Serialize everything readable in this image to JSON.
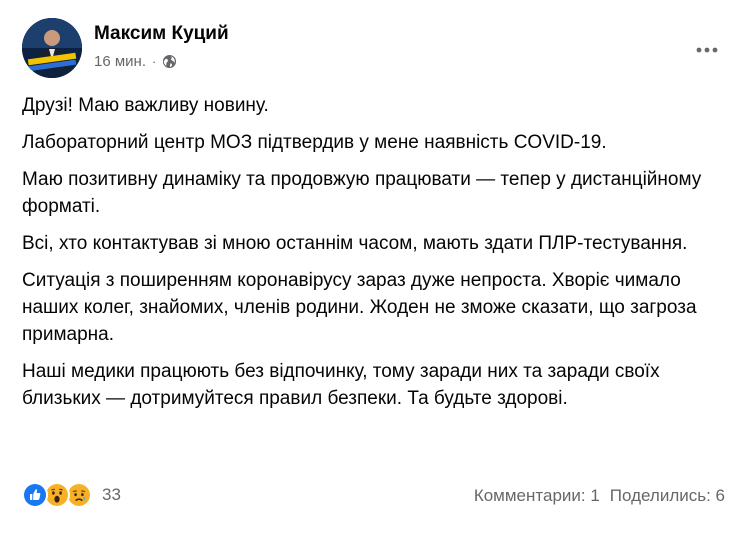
{
  "post": {
    "author": "Максим Куций",
    "time": "16 мин.",
    "separator": "·",
    "paragraphs": [
      "Друзі! Маю важливу новину.",
      "Лабораторний центр МОЗ підтвердив у мене наявність COVID-19.",
      "Маю позитивну динаміку та продовжую працювати — тепер у дистанційному форматі.",
      "Всі, хто контактував зі мною останнім часом, мають здати ПЛР-тестування.",
      "Ситуація з поширенням коронавірусу зараз дуже непроста. Хворіє чимало наших колег, знайомих, членів родини. Жоден не зможе сказати, що загроза примарна.",
      "Наші медики працюють без відпочинку, тому заради них та заради своїх близьких — дотримуйтеся правил безпеки. Та будьте здорові."
    ]
  },
  "footer": {
    "reaction_icons": [
      "like-icon",
      "wow-icon",
      "sad-icon"
    ],
    "reaction_count": "33",
    "comments": "Комментарии: 1",
    "shares": "Поделились: 6"
  },
  "colors": {
    "secondary_text": "#65676b",
    "like_blue": "#1877f2",
    "emoji_yellow": "#f7b125"
  }
}
